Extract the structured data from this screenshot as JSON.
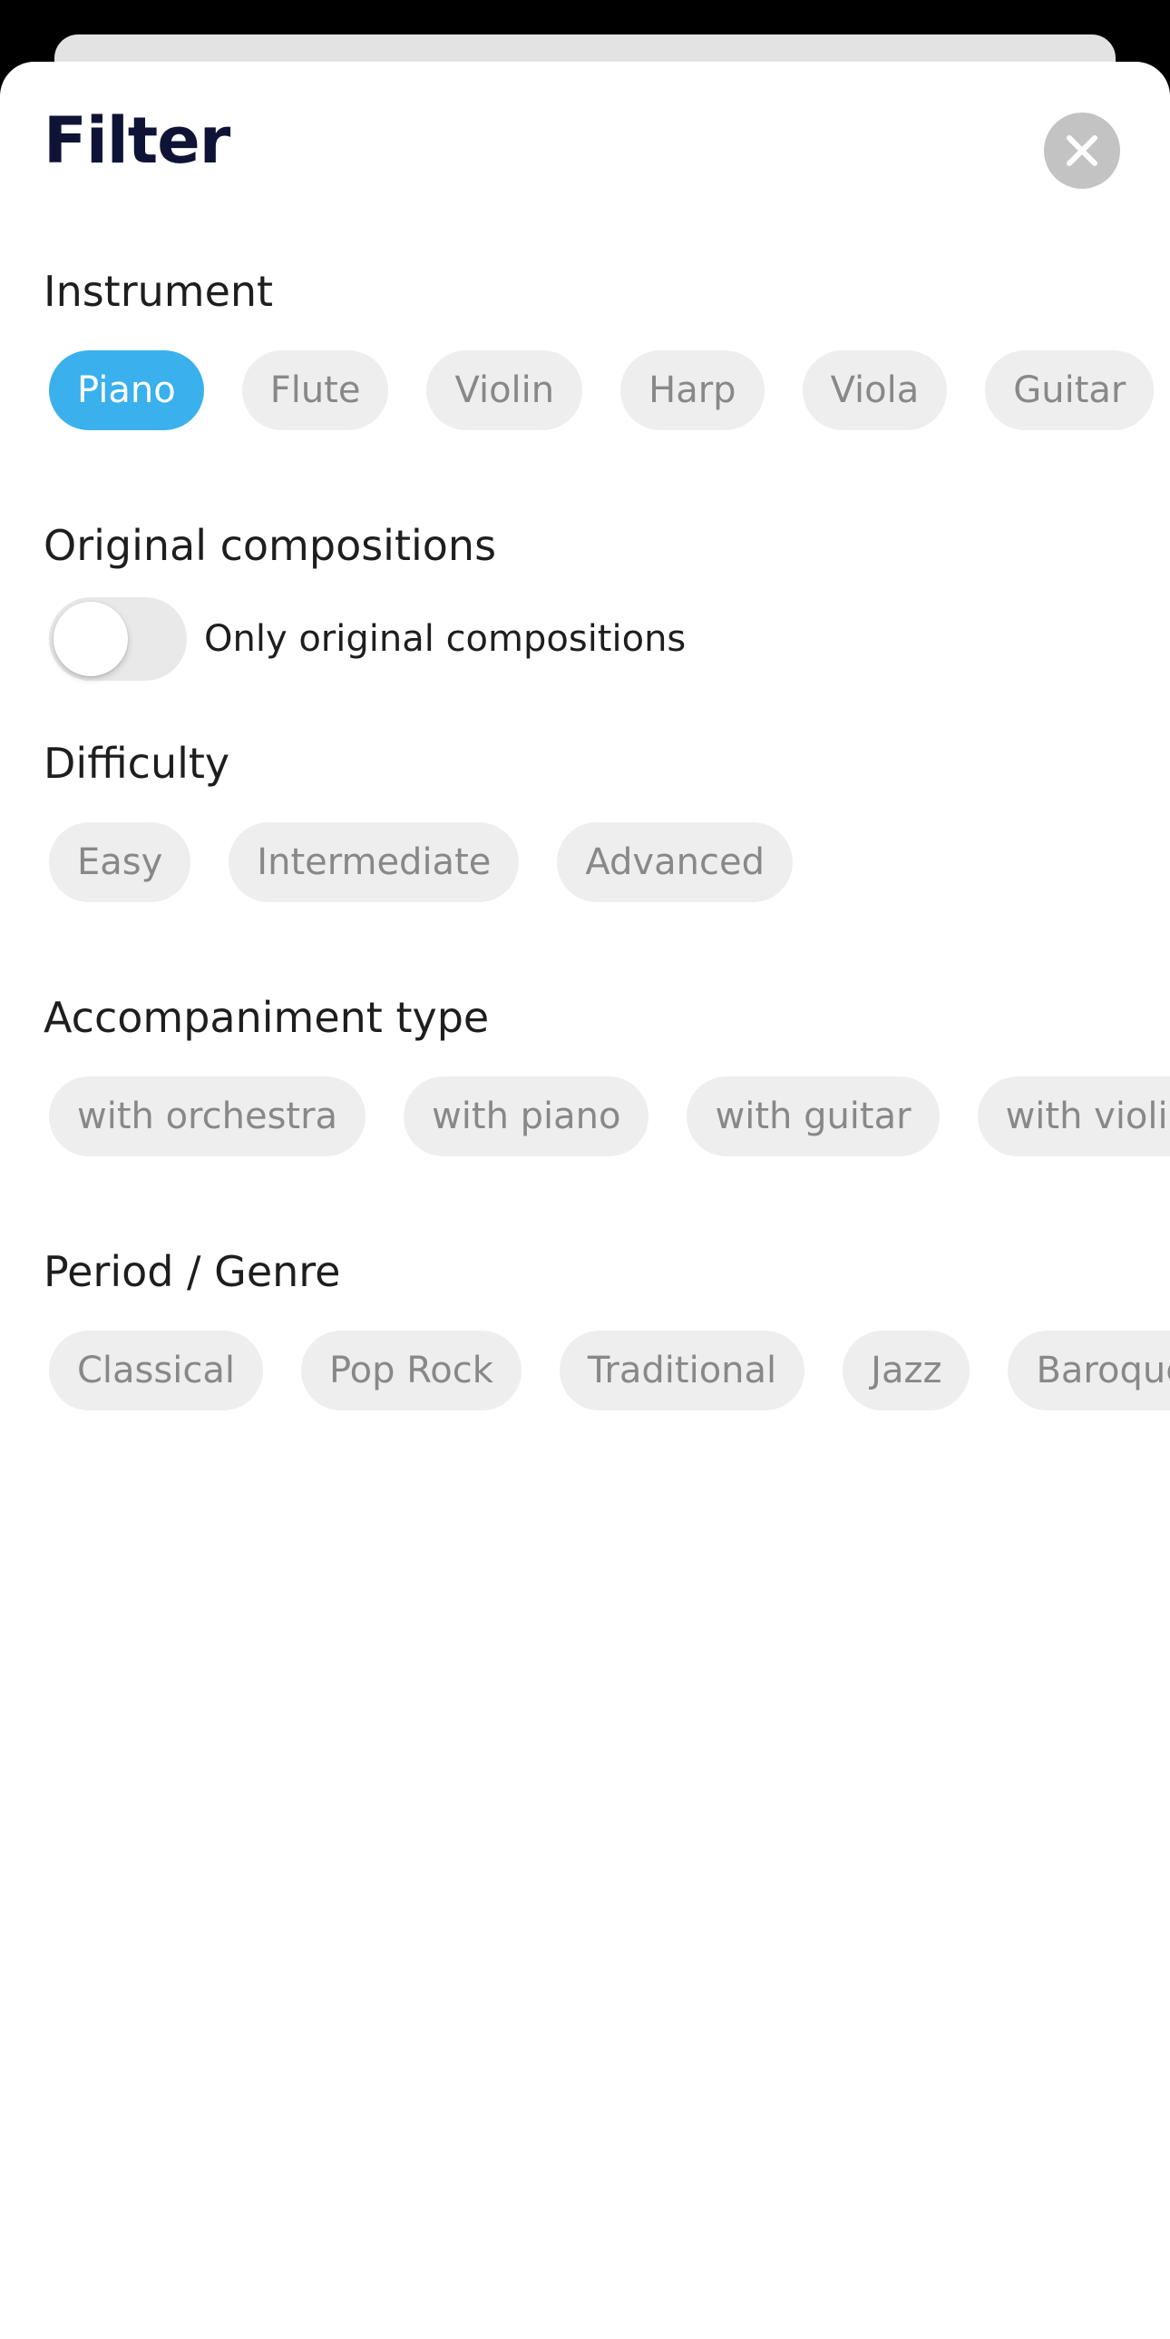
{
  "sheet": {
    "title": "Filter",
    "close_icon": "close-icon"
  },
  "instrument": {
    "title": "Instrument",
    "options": [
      "Piano",
      "Flute",
      "Violin",
      "Harp",
      "Viola",
      "Guitar"
    ],
    "selected": "Piano"
  },
  "original": {
    "title": "Original compositions",
    "toggle_label": "Only original compositions",
    "toggle_on": false
  },
  "difficulty": {
    "title": "Difficulty",
    "options": [
      "Easy",
      "Intermediate",
      "Advanced"
    ]
  },
  "accompaniment": {
    "title": "Accompaniment type",
    "options": [
      "with orchestra",
      "with piano",
      "with guitar",
      "with violin"
    ]
  },
  "period": {
    "title": "Period / Genre",
    "options": [
      "Classical",
      "Pop Rock",
      "Traditional",
      "Jazz",
      "Baroque"
    ]
  },
  "colors": {
    "accent": "#3ab0ec",
    "title": "#0f1437",
    "chip_bg": "#eeeeee",
    "chip_text": "#888888"
  }
}
